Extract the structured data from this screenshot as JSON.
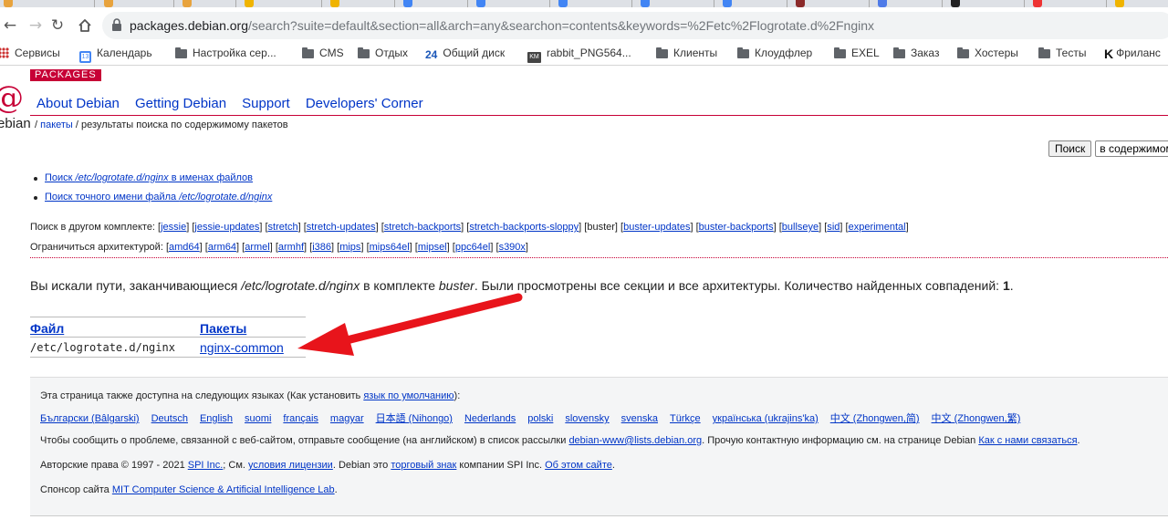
{
  "browser": {
    "url_host": "packages.debian.org",
    "url_path": "/search?suite=default&section=all&arch=any&searchon=contents&keywords=%2Fetc%2Flogrotate.d%2Fnginx",
    "bookmarks": [
      {
        "label": "Сервисы",
        "icon": "apps-grid-icon"
      },
      {
        "label": "Календарь",
        "icon": "calendar-icon"
      },
      {
        "label": "Настройка сер...",
        "icon": "folder-icon"
      },
      {
        "label": "CMS",
        "icon": "folder-icon"
      },
      {
        "label": "Отдых",
        "icon": "folder-icon"
      },
      {
        "label": "Общий диск",
        "icon": "drive24-icon"
      },
      {
        "label": "rabbit_PNG564...",
        "icon": "image-icon"
      },
      {
        "label": "Клиенты",
        "icon": "folder-icon"
      },
      {
        "label": "Клоудфлер",
        "icon": "folder-icon"
      },
      {
        "label": "EXEL",
        "icon": "folder-icon"
      },
      {
        "label": "Заказ",
        "icon": "folder-icon"
      },
      {
        "label": "Хостеры",
        "icon": "folder-icon"
      },
      {
        "label": "Тесты",
        "icon": "folder-icon"
      },
      {
        "label": "Фриланс",
        "icon": "kwork-icon"
      }
    ]
  },
  "site": {
    "badge": "PACKAGES",
    "logo_word": "ebian",
    "nav": [
      "About Debian",
      "Getting Debian",
      "Support",
      "Developers' Corner"
    ],
    "crumb_sep1": "/",
    "crumb_link": "пакеты",
    "crumb_rest": "/ результаты поиска по содержимому пакетов",
    "search_button": "Поиск",
    "search_select": "в содержимом пакетов"
  },
  "hints": {
    "h1_prefix": "Поиск ",
    "h1_term": "/etc/logrotate.d/nginx",
    "h1_suffix": " в именах файлов",
    "h2_prefix": "Поиск точного имени файла ",
    "h2_term": "/etc/logrotate.d/nginx"
  },
  "suites": {
    "label": "Поиск в другом комплекте: ",
    "items": [
      "jessie",
      "jessie-updates",
      "stretch",
      "stretch-updates",
      "stretch-backports",
      "stretch-backports-sloppy",
      "buster",
      "buster-updates",
      "buster-backports",
      "bullseye",
      "sid",
      "experimental"
    ],
    "current": "buster"
  },
  "archs": {
    "label": "Ограничиться архитектурой: ",
    "items": [
      "amd64",
      "arm64",
      "armel",
      "armhf",
      "i386",
      "mips",
      "mips64el",
      "mipsel",
      "ppc64el",
      "s390x"
    ]
  },
  "summary": {
    "p1": "Вы искали пути, заканчивающиеся ",
    "term": "/etc/logrotate.d/nginx",
    "p2": " в комплекте ",
    "suite": "buster",
    "p3": ". Были просмотрены все секции и все архитектуры. Количество найденных совпадений: ",
    "count": "1",
    "p4": "."
  },
  "results": {
    "col_file": "Файл",
    "col_packages": "Пакеты",
    "rows": [
      {
        "file": "/etc/logrotate.d/nginx",
        "package": "nginx-common"
      }
    ]
  },
  "annotation": {
    "color": "#e8141b"
  },
  "footer": {
    "langs_intro": "Эта страница также доступна на следующих языках (Как установить ",
    "langs_link": "язык по умолчанию",
    "langs_end": "):",
    "languages": [
      "Български (Bâlgarski)",
      "Deutsch",
      "English",
      "suomi",
      "français",
      "magyar",
      "日本語 (Nihongo)",
      "Nederlands",
      "polski",
      "slovensky",
      "svenska",
      "Türkçe",
      "українська (ukrajins'ka)",
      "中文 (Zhongwen,简)",
      "中文 (Zhongwen,繁)"
    ],
    "report_text": "Чтобы сообщить о проблеме, связанной с веб-сайтом, отправьте сообщение (на английском) в список рассылки ",
    "report_email": "debian-www@lists.debian.org",
    "report_text2": ". Прочую контактную информацию см. на странице Debian ",
    "report_contact": "Как с нами связаться",
    "report_end": ".",
    "copy_text": "Авторские права © 1997 - 2021 ",
    "copy_spi": "SPI Inc.",
    "copy_see": "; См. ",
    "copy_license": "условия лицензии",
    "copy_mid": ". Debian это ",
    "copy_tm": "торговый знак",
    "copy_company": " компании SPI Inc. ",
    "copy_about": "Об этом сайте",
    "copy_end": ".",
    "sponsor_text": "Спонсор сайта ",
    "sponsor_link": "MIT Computer Science & Artificial Intelligence Lab",
    "sponsor_end": "."
  }
}
